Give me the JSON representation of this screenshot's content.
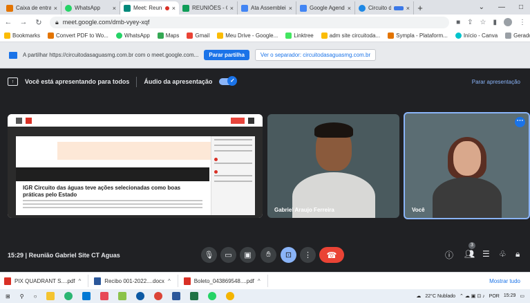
{
  "browser": {
    "tabs": [
      {
        "title": "Caixa de entrada",
        "color": "#e37400",
        "active": false
      },
      {
        "title": "WhatsApp",
        "color": "#25d366",
        "active": false
      },
      {
        "title": "Meet: Reunião",
        "color": "#00897b",
        "active": true,
        "recording": true
      },
      {
        "title": "REUNIÕES - Goo",
        "color": "#0f9d58",
        "active": false
      },
      {
        "title": "Ata Assembleia",
        "color": "#4285f4",
        "active": false
      },
      {
        "title": "Google Agenda",
        "color": "#4285f4",
        "active": false
      },
      {
        "title": "Circuito das",
        "color": "#1e88e5",
        "active": false
      }
    ],
    "new_tab_label": "+",
    "url": "meet.google.com/dmb-vyey-xqf",
    "bookmarks": [
      {
        "label": "Bookmarks",
        "color": "#fbbc04"
      },
      {
        "label": "Convert PDF to Wo...",
        "color": "#e37400"
      },
      {
        "label": "WhatsApp",
        "color": "#25d366"
      },
      {
        "label": "Maps",
        "color": "#34a853"
      },
      {
        "label": "Gmail",
        "color": "#ea4335"
      },
      {
        "label": "Meu Drive - Google...",
        "color": "#fbbc04"
      },
      {
        "label": "Linktree",
        "color": "#43e660"
      },
      {
        "label": "adm site circuitoda...",
        "color": "#fbbc04"
      },
      {
        "label": "Sympla - Plataform...",
        "color": "#e37400"
      },
      {
        "label": "Início - Canva",
        "color": "#00c4cc"
      },
      {
        "label": "Gerador de nuvem...",
        "color": "#5f6368"
      }
    ]
  },
  "share_bar": {
    "text": "A partilhar https://circuitodasaguasmg.com.br com o meet.google.com...",
    "stop_button": "Parar partilha",
    "switch_button": "Ver o separador: circuitodasaguasmg.com.br"
  },
  "presentation": {
    "status": "Você está apresentando para todos",
    "audio_label": "Áudio da apresentação",
    "stop_label": "Parar apresentação"
  },
  "shared_page": {
    "headline": "IGR Circuito das águas teve ações selecionadas como boas práticas pelo Estado"
  },
  "participants": [
    {
      "name": "Gabriel Araujo Ferreira"
    },
    {
      "name": "Você"
    }
  ],
  "meeting": {
    "time": "15:29",
    "title": "Reunião Gabriel Site CT Aguas",
    "people_count": "3"
  },
  "downloads": [
    {
      "name": "PIX QUADRANT S....pdf",
      "color": "#d93025"
    },
    {
      "name": "Recibo 001-2022....docx",
      "color": "#2b579a"
    },
    {
      "name": "Boleto_043869548....pdf",
      "color": "#d93025"
    }
  ],
  "show_all_label": "Mostrar tudo",
  "taskbar": {
    "weather": "22°C  Nublado",
    "lang": "POR",
    "clock_time": "15:29"
  }
}
